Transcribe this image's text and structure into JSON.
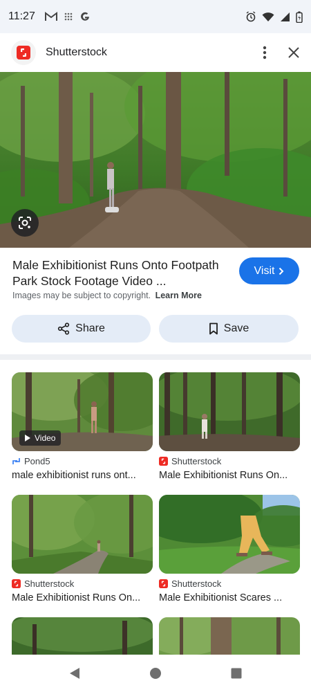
{
  "status_bar": {
    "time": "11:27",
    "left_icons": [
      "gmail-icon",
      "grid-dots-icon",
      "google-g-icon"
    ],
    "right_icons": [
      "alarm-icon",
      "wifi-icon",
      "signal-icon",
      "battery-icon"
    ]
  },
  "header": {
    "site_name": "Shutterstock",
    "logo_color": "#ee2b24"
  },
  "result": {
    "title": "Male Exhibitionist Runs Onto Footpath Park Stock Footage Video ...",
    "visit_label": "Visit",
    "copyright_text": "Images may be subject to copyright.",
    "learn_more": "Learn More",
    "share_label": "Share",
    "save_label": "Save"
  },
  "related": [
    {
      "source": "Pond5",
      "source_icon": "pond5-icon",
      "title": "male exhibitionist runs ont...",
      "badge": "Video"
    },
    {
      "source": "Shutterstock",
      "source_icon": "shutterstock-icon",
      "title": "Male Exhibitionist Runs On..."
    },
    {
      "source": "Shutterstock",
      "source_icon": "shutterstock-icon",
      "title": "Male Exhibitionist Runs On..."
    },
    {
      "source": "Shutterstock",
      "source_icon": "shutterstock-icon",
      "title": "Male Exhibitionist Scares ..."
    }
  ],
  "colors": {
    "accent": "#1a73e8",
    "button_bg": "#e4ecf7",
    "status_bg": "#f1f4f9"
  }
}
